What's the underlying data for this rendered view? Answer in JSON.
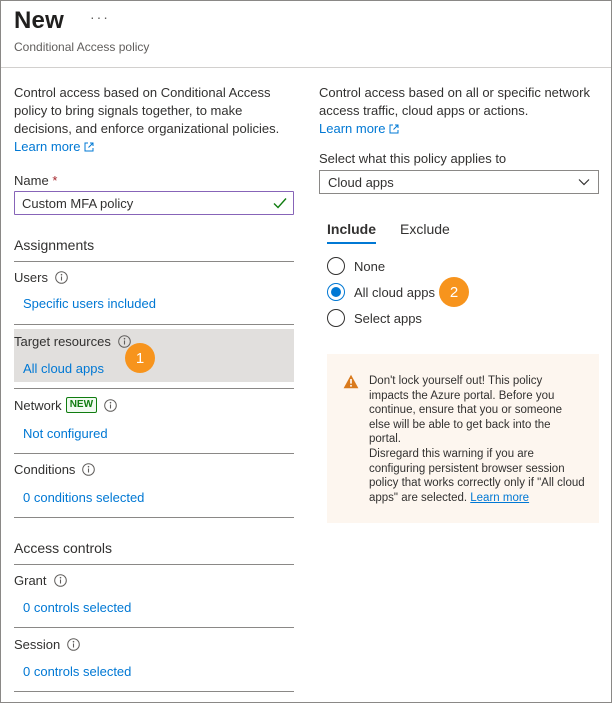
{
  "header": {
    "title": "New",
    "more": "···",
    "subtitle": "Conditional Access policy"
  },
  "left": {
    "description": "Control access based on Conditional Access policy to bring signals together, to make decisions, and enforce organizational policies.",
    "learn_more": "Learn more",
    "name_label": "Name",
    "required_mark": "*",
    "name_value": "Custom MFA policy",
    "assignments_title": "Assignments",
    "users": {
      "label": "Users",
      "value": "Specific users included"
    },
    "target_resources": {
      "label": "Target resources",
      "value": "All cloud apps",
      "step": "1"
    },
    "network": {
      "label": "Network",
      "badge": "NEW",
      "value": "Not configured"
    },
    "conditions": {
      "label": "Conditions",
      "value": "0 conditions selected"
    },
    "access_controls_title": "Access controls",
    "grant": {
      "label": "Grant",
      "value": "0 controls selected"
    },
    "session": {
      "label": "Session",
      "value": "0 controls selected"
    }
  },
  "right": {
    "description": "Control access based on all or specific network access traffic, cloud apps or actions.",
    "learn_more": "Learn more",
    "select_label": "Select what this policy applies to",
    "select_value": "Cloud apps",
    "tabs": [
      "Include",
      "Exclude"
    ],
    "radios": [
      {
        "label": "None",
        "checked": false
      },
      {
        "label": "All cloud apps",
        "checked": true
      },
      {
        "label": "Select apps",
        "checked": false
      }
    ],
    "step": "2",
    "warning": {
      "line1": "Don't lock yourself out! This policy impacts the Azure portal. Before you continue, ensure that you or someone else will be able to get back into the portal.",
      "line2": "Disregard this warning if you are configuring persistent browser session policy that works correctly only if \"All cloud apps\" are selected.",
      "learn_more": "Learn more"
    }
  },
  "colors": {
    "accent": "#0078d4",
    "badge": "#f7941d",
    "valid_border": "#8764b8",
    "new_badge": "#107c10",
    "warning_icon": "#d97a1d"
  }
}
